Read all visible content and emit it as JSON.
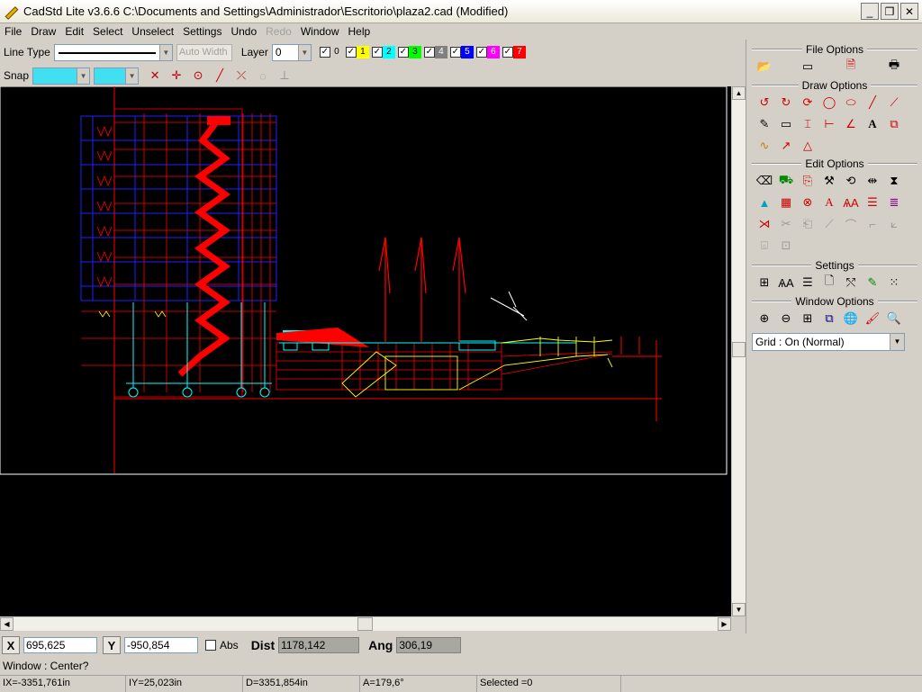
{
  "window": {
    "title": "CadStd Lite v3.6.6  C:\\Documents and Settings\\Administrador\\Escritorio\\plaza2.cad  (Modified)"
  },
  "menu": [
    "File",
    "Draw",
    "Edit",
    "Select",
    "Unselect",
    "Settings",
    "Undo",
    "Redo",
    "Window",
    "Help"
  ],
  "toolbar": {
    "line_type_label": "Line Type",
    "auto_width_placeholder": "Auto Width",
    "layer_label": "Layer",
    "layer_value": "0",
    "layers": [
      {
        "num": "0",
        "color": "#d4d0c8",
        "text": "#000000"
      },
      {
        "num": "1",
        "color": "#ffff00",
        "text": "#000000"
      },
      {
        "num": "2",
        "color": "#00ffff",
        "text": "#000000"
      },
      {
        "num": "3",
        "color": "#00ff00",
        "text": "#000000"
      },
      {
        "num": "4",
        "color": "#808080",
        "text": "#ffffff"
      },
      {
        "num": "5",
        "color": "#0000ff",
        "text": "#ffffff"
      },
      {
        "num": "6",
        "color": "#ff00ff",
        "text": "#ffffff"
      },
      {
        "num": "7",
        "color": "#ff0000",
        "text": "#ffffff"
      }
    ],
    "snap_label": "Snap"
  },
  "panel": {
    "file_options": "File Options",
    "draw_options": "Draw Options",
    "edit_options": "Edit Options",
    "settings": "Settings",
    "window_options": "Window Options",
    "grid_value": "Grid : On (Normal)"
  },
  "coords": {
    "x_label": "X",
    "x_value": "695,625",
    "y_label": "Y",
    "y_value": "-950,854",
    "abs_label": "Abs",
    "dist_label": "Dist",
    "dist_value": "1178,142",
    "ang_label": "Ang",
    "ang_value": "306,19"
  },
  "prompt": "Window : Center?",
  "status": [
    "IX=-3351,761in",
    "IY=25,023in",
    "D=3351,854in",
    "A=179,6°",
    "Selected =0"
  ],
  "colors": {
    "accent_red": "#ff0000",
    "blue": "#2020ff",
    "cyan": "#00ffff",
    "yellow": "#ffff00",
    "canvas": "#000000"
  }
}
